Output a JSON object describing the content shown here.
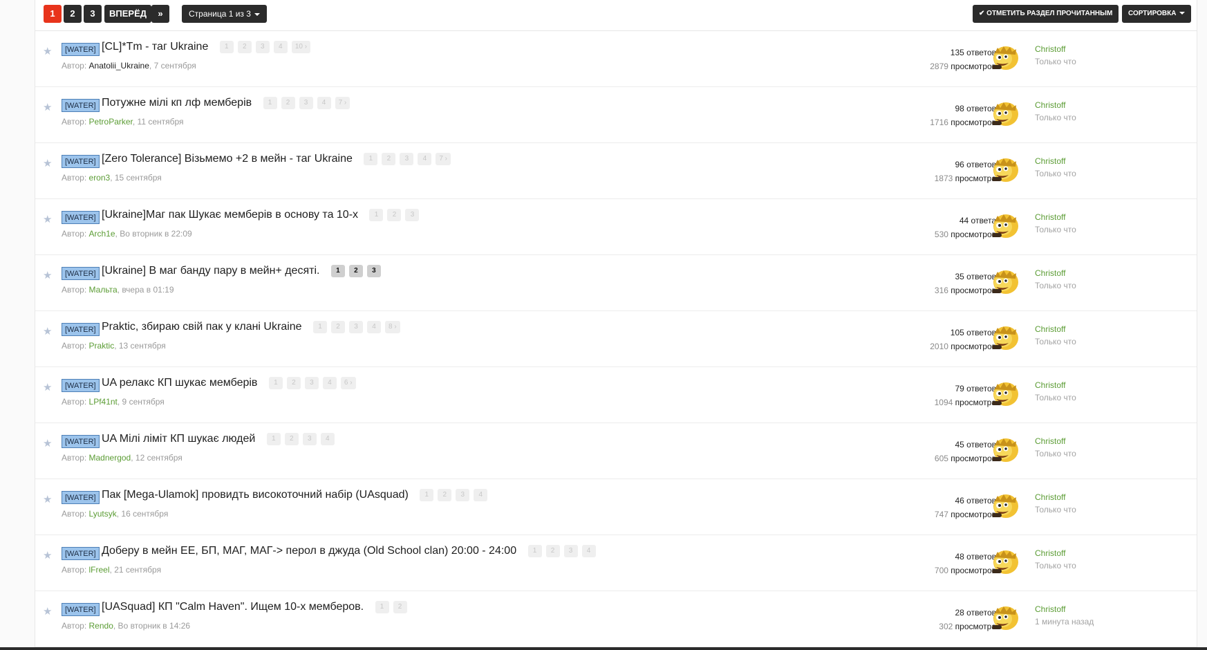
{
  "pagination": {
    "pages": [
      "1",
      "2",
      "3"
    ],
    "active": "1",
    "next_label": "ВПЕРЁД",
    "last_label": "»",
    "page_select": "Страница 1 из 3"
  },
  "toolbar": {
    "mark_read": "ОТМЕТИТЬ РАЗДЕЛ ПРОЧИТАННЫМ",
    "sort": "СОРТИРОВКА"
  },
  "colors": {
    "accent_active_page": "#e8341c",
    "dark_button": "#2b2b2b",
    "prefix_bg": "#9cc4ec",
    "username": "#5b9c34"
  },
  "threads": [
    {
      "prefix": "[WATER]",
      "title": "[CL]*Tm - таг Ukraine",
      "pages": [
        "1",
        "2",
        "3",
        "4",
        "10 ›"
      ],
      "author_label": "Автор:",
      "author": "Anatolii_Ukraine",
      "date": ", 7 сентября",
      "replies": "135",
      "replies_word": " ответов",
      "views": "2879",
      "views_word": " просмотров",
      "last_user": "Christoff",
      "last_time": "Только что"
    },
    {
      "prefix": "[WATER]",
      "title": "Потужне мілі кп лф мемберів",
      "pages": [
        "1",
        "2",
        "3",
        "4",
        "7 ›"
      ],
      "author_label": "Автор:",
      "author": "PetroParker",
      "date": ", 11 сентября",
      "replies": "98",
      "replies_word": " ответов",
      "views": "1716",
      "views_word": " просмотров",
      "last_user": "Christoff",
      "last_time": "Только что"
    },
    {
      "prefix": "[WATER]",
      "title": "[Zero Tolerance] Візьмемо +2 в мейн - таг Ukraine",
      "pages": [
        "1",
        "2",
        "3",
        "4",
        "7 ›"
      ],
      "author_label": "Автор:",
      "author": "eron3",
      "date": ", 15 сентября",
      "replies": "96",
      "replies_word": " ответов",
      "views": "1873",
      "views_word": " просмотра",
      "last_user": "Christoff",
      "last_time": "Только что"
    },
    {
      "prefix": "[WATER]",
      "title": "[Ukraine]Маг пак Шукає мемберів в основу та 10-х",
      "pages": [
        "1",
        "2",
        "3"
      ],
      "author_label": "Автор:",
      "author": "Arch1e",
      "date": ", Во вторник в 22:09",
      "replies": "44",
      "replies_word": " ответа",
      "views": "530",
      "views_word": " просмотров",
      "last_user": "Christoff",
      "last_time": "Только что"
    },
    {
      "prefix": "[WATER]",
      "title": "[Ukraine] В маг банду пару в мейн+ десяті.",
      "pages": [
        "1",
        "2",
        "3"
      ],
      "highlight": true,
      "author_label": "Автор:",
      "author": "Мальта",
      "date": ", вчера в 01:19",
      "replies": "35",
      "replies_word": " ответов",
      "views": "316",
      "views_word": " просмотров",
      "last_user": "Christoff",
      "last_time": "Только что"
    },
    {
      "prefix": "[WATER]",
      "title": "Praktic, збираю свій пак у клані Ukraine",
      "pages": [
        "1",
        "2",
        "3",
        "4",
        "8 ›"
      ],
      "author_label": "Автор:",
      "author": "Praktic",
      "date": ", 13 сентября",
      "replies": "105",
      "replies_word": " ответов",
      "views": "2010",
      "views_word": " просмотров",
      "last_user": "Christoff",
      "last_time": "Только что"
    },
    {
      "prefix": "[WATER]",
      "title": "UA релакс КП шукає мемберів",
      "pages": [
        "1",
        "2",
        "3",
        "4",
        "6 ›"
      ],
      "author_label": "Автор:",
      "author": "LPf41nt",
      "date": ", 9 сентября",
      "replies": "79",
      "replies_word": " ответов",
      "views": "1094",
      "views_word": " просмотра",
      "last_user": "Christoff",
      "last_time": "Только что"
    },
    {
      "prefix": "[WATER]",
      "title": "UA Мілі ліміт КП шукає людей",
      "pages": [
        "1",
        "2",
        "3",
        "4"
      ],
      "author_label": "Автор:",
      "author": "Madnergod",
      "date": ", 12 сентября",
      "replies": "45",
      "replies_word": " ответов",
      "views": "605",
      "views_word": " просмотров",
      "last_user": "Christoff",
      "last_time": "Только что"
    },
    {
      "prefix": "[WATER]",
      "title": "Пак [Mega-Ulamok] провидть високоточний набір (UAsquad)",
      "pages": [
        "1",
        "2",
        "3",
        "4"
      ],
      "author_label": "Автор:",
      "author": "Lyutsyk",
      "date": ", 16 сентября",
      "replies": "46",
      "replies_word": " ответов",
      "views": "747",
      "views_word": " просмотров",
      "last_user": "Christoff",
      "last_time": "Только что"
    },
    {
      "prefix": "[WATER]",
      "title": "Доберу в мейн ЕЕ, БП, МАГ, МАГ-> перол в джуда (Old School clan) 20:00 - 24:00",
      "pages": [
        "1",
        "2",
        "3",
        "4"
      ],
      "author_label": "Автор:",
      "author": "lFreel",
      "date": ", 21 сентября",
      "replies": "48",
      "replies_word": " ответов",
      "views": "700",
      "views_word": " просмотров",
      "last_user": "Christoff",
      "last_time": "Только что"
    },
    {
      "prefix": "[WATER]",
      "title": "[UASquad] КП \"Calm Haven\". Ищем 10-х мемберов.",
      "pages": [
        "1",
        "2"
      ],
      "author_label": "Автор:",
      "author": "Rendo",
      "date": ", Во вторник в 14:26",
      "replies": "28",
      "replies_word": " ответов",
      "views": "302",
      "views_word": " просмотра",
      "last_user": "Christoff",
      "last_time": "1 минута назад"
    }
  ]
}
